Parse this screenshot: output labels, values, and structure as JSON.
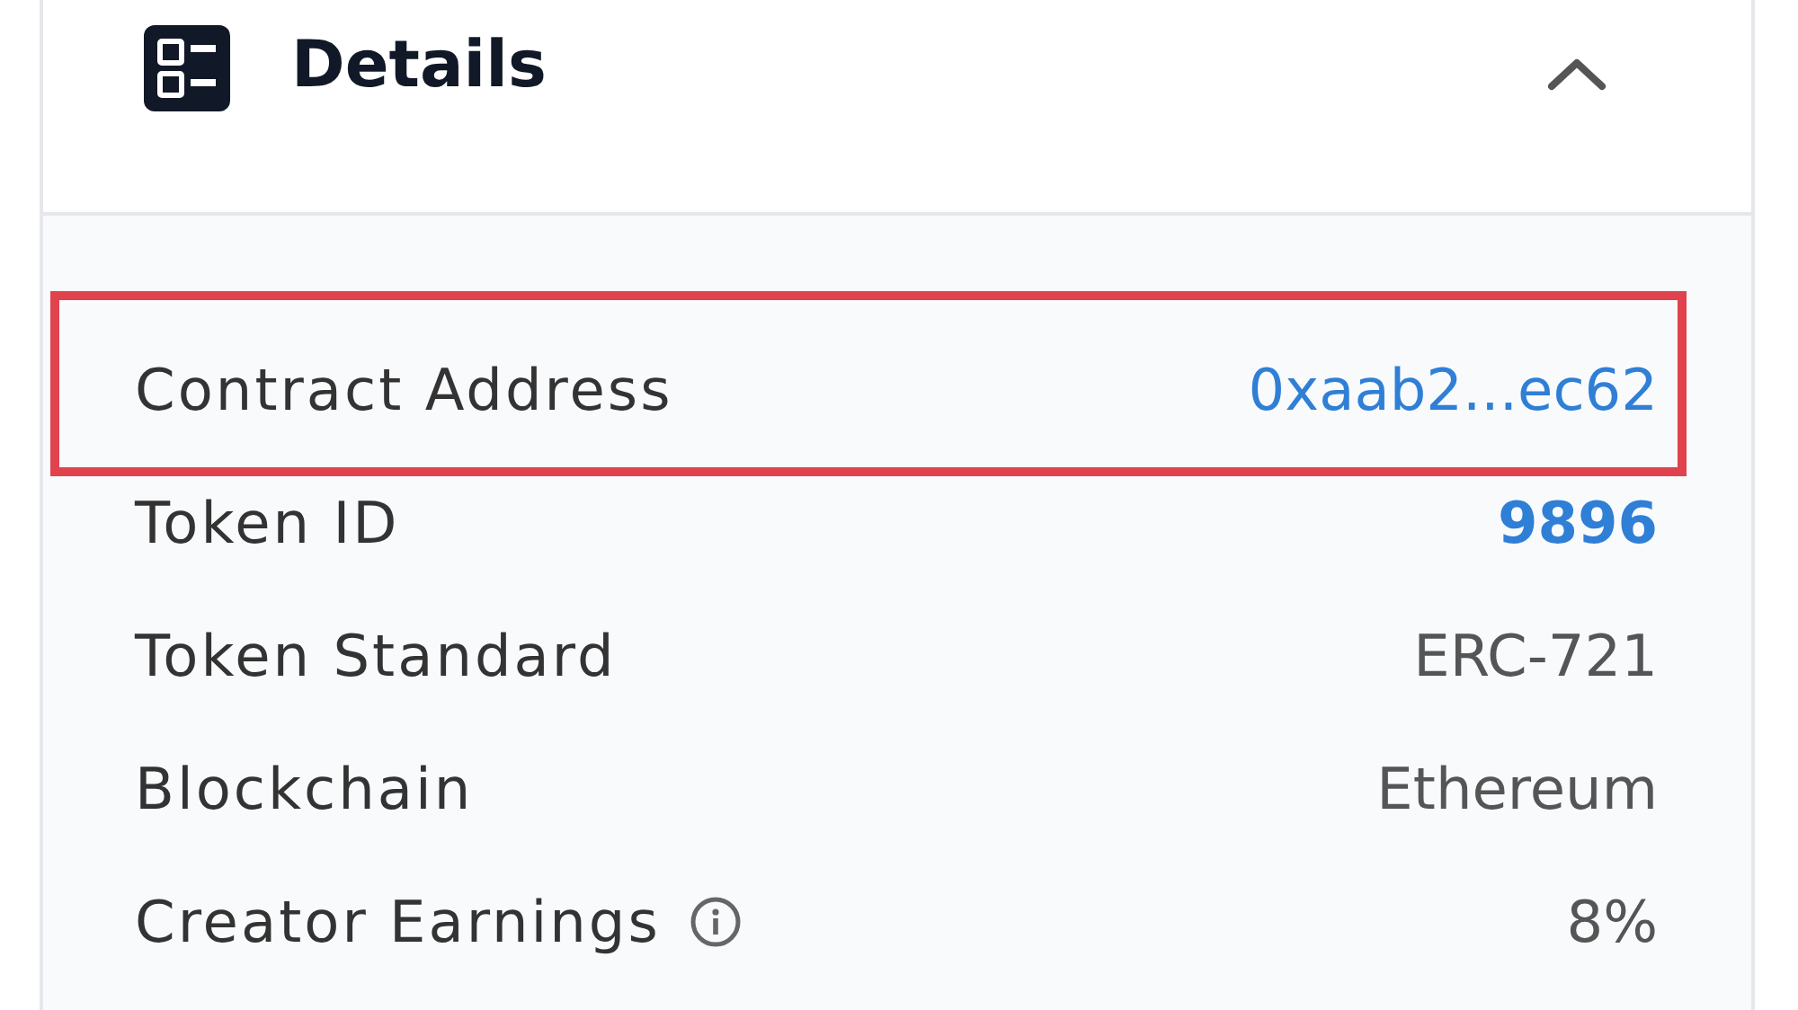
{
  "panel": {
    "title": "Details",
    "expanded": true
  },
  "rows": [
    {
      "label": "Contract Address",
      "value": "0xaab2...ec62",
      "kind": "link",
      "highlighted": true,
      "info": false
    },
    {
      "label": "Token ID",
      "value": "9896",
      "kind": "link",
      "highlighted": false,
      "info": false
    },
    {
      "label": "Token Standard",
      "value": "ERC-721",
      "kind": "text",
      "highlighted": false,
      "info": false
    },
    {
      "label": "Blockchain",
      "value": "Ethereum",
      "kind": "text",
      "highlighted": false,
      "info": false
    },
    {
      "label": "Creator Earnings",
      "value": "8%",
      "kind": "text",
      "highlighted": false,
      "info": true
    }
  ]
}
